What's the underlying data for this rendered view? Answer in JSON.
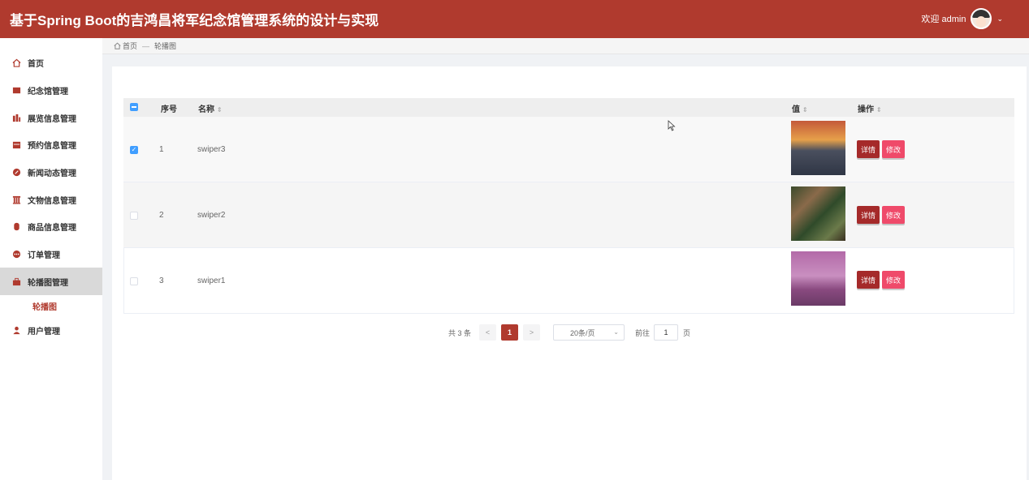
{
  "header": {
    "title": "基于Spring Boot的吉鸿昌将军纪念馆管理系统的设计与实现",
    "welcome": "欢迎 admin"
  },
  "sidebar": {
    "items": [
      {
        "label": "首页",
        "icon": "home-icon"
      },
      {
        "label": "纪念馆管理",
        "icon": "building-icon"
      },
      {
        "label": "展览信息管理",
        "icon": "exhibit-icon"
      },
      {
        "label": "预约信息管理",
        "icon": "calendar-icon"
      },
      {
        "label": "新闻动态管理",
        "icon": "news-icon"
      },
      {
        "label": "文物信息管理",
        "icon": "relic-icon"
      },
      {
        "label": "商品信息管理",
        "icon": "goods-icon"
      },
      {
        "label": "订单管理",
        "icon": "order-icon"
      },
      {
        "label": "轮播图管理",
        "icon": "carousel-icon"
      },
      {
        "label": "用户管理",
        "icon": "user-icon"
      }
    ],
    "sub_item": "轮播图"
  },
  "breadcrumb": {
    "home": "首页",
    "separator": "—",
    "current": "轮播图"
  },
  "table": {
    "columns": {
      "index": "序号",
      "name": "名称",
      "value": "值",
      "actions": "操作"
    },
    "rows": [
      {
        "index": "1",
        "name": "swiper3",
        "checked": true,
        "detail": "详情",
        "edit": "修改"
      },
      {
        "index": "2",
        "name": "swiper2",
        "checked": false,
        "detail": "详情",
        "edit": "修改"
      },
      {
        "index": "3",
        "name": "swiper1",
        "checked": false,
        "detail": "详情",
        "edit": "修改"
      }
    ]
  },
  "pagination": {
    "total": "共 3 条",
    "prev": "<",
    "current": "1",
    "next": ">",
    "page_size": "20条/页",
    "goto_label": "前往",
    "goto_value": "1",
    "page_suffix": "页"
  },
  "colors": {
    "brand": "#b03a2e",
    "detail_button": "#a52a2a",
    "edit_button": "#ef4a6a",
    "checkbox": "#409eff"
  }
}
